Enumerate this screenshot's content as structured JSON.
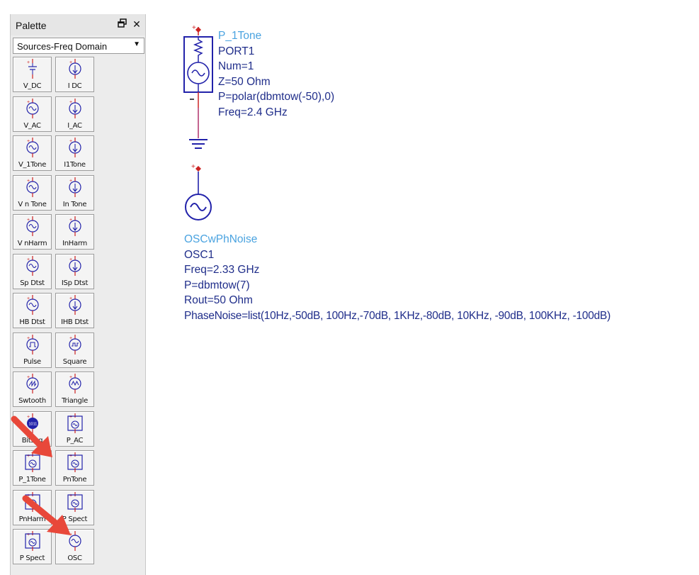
{
  "palette": {
    "title": "Palette",
    "float_icon": "float-window-icon",
    "close_icon": "close-icon",
    "category": "Sources-Freq Domain",
    "items": [
      {
        "label": "V_DC",
        "icon": "dc-voltage-source-icon"
      },
      {
        "label": "I DC",
        "icon": "dc-current-source-icon"
      },
      {
        "label": "V_AC",
        "icon": "ac-voltage-source-icon"
      },
      {
        "label": "I_AC",
        "icon": "ac-current-source-icon"
      },
      {
        "label": "V_1Tone",
        "icon": "1tone-voltage-source-icon"
      },
      {
        "label": "I1Tone",
        "icon": "1tone-current-source-icon"
      },
      {
        "label": "V n Tone",
        "icon": "ntone-voltage-source-icon"
      },
      {
        "label": "In Tone",
        "icon": "ntone-current-source-icon"
      },
      {
        "label": "V nHarm",
        "icon": "nharm-voltage-source-icon"
      },
      {
        "label": "InHarm",
        "icon": "nharm-current-source-icon"
      },
      {
        "label": "Sp Dtst",
        "icon": "spectrum-voltage-source-icon"
      },
      {
        "label": "ISp Dtst",
        "icon": "spectrum-current-source-icon"
      },
      {
        "label": "HB Dtst",
        "icon": "hb-voltage-source-icon"
      },
      {
        "label": "IHB Dtst",
        "icon": "hb-current-source-icon"
      },
      {
        "label": "Pulse",
        "icon": "pulse-source-icon"
      },
      {
        "label": "Square",
        "icon": "square-source-icon"
      },
      {
        "label": "Swtooth",
        "icon": "sawtooth-source-icon"
      },
      {
        "label": "Triangle",
        "icon": "triangle-source-icon"
      },
      {
        "label": "Bitseq",
        "icon": "bitseq-source-icon"
      },
      {
        "label": "P_AC",
        "icon": "ac-port-icon"
      },
      {
        "label": "P_1Tone",
        "icon": "1tone-port-icon"
      },
      {
        "label": "PnTone",
        "icon": "ntone-port-icon"
      },
      {
        "label": "PnHarm",
        "icon": "nharm-port-icon"
      },
      {
        "label": "P Spect",
        "icon": "spectrum-port-icon"
      },
      {
        "label": "P Spect",
        "icon": "fds-spectrum-port-icon"
      },
      {
        "label": "OSC",
        "icon": "oscillator-icon"
      }
    ]
  },
  "schematic": {
    "port": {
      "type": "P_1Tone",
      "name": "PORT1",
      "params": [
        "Num=1",
        "Z=50 Ohm",
        "P=polar(dbmtow(-50),0)",
        "Freq=2.4 GHz"
      ]
    },
    "osc": {
      "type": "OSCwPhNoise",
      "name": "OSC1",
      "params": [
        "Freq=2.33 GHz",
        "P=dbmtow(7)",
        "Rout=50 Ohm",
        "PhaseNoise=list(10Hz,-50dB, 100Hz,-70dB, 1KHz,-80dB, 10KHz, -90dB, 100KHz, -100dB)"
      ]
    }
  },
  "colors": {
    "component_name": "#4aa3e0",
    "component_text": "#1f2d8a",
    "symbol": "#2222aa",
    "pin": "#cc2222",
    "wire": "#b0306a",
    "highlight_arrow": "#e8483a"
  }
}
